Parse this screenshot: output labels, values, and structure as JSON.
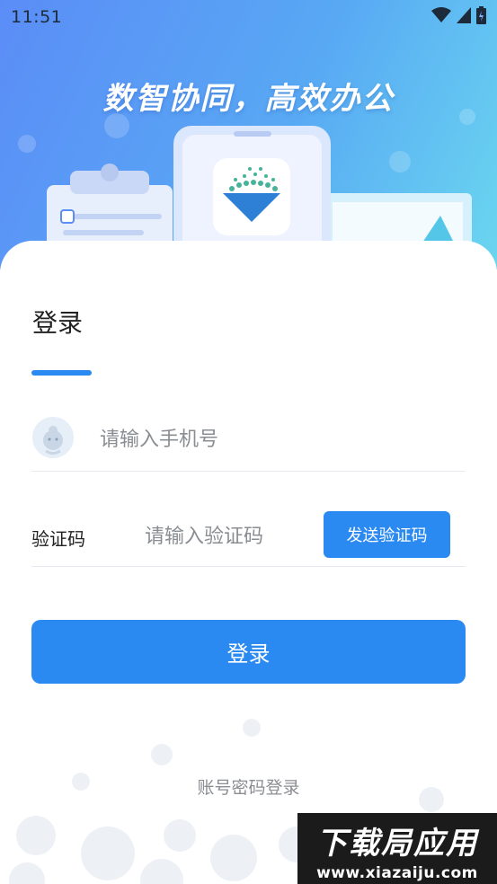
{
  "status_bar": {
    "time": "11:51"
  },
  "hero": {
    "slogan": "数智协同，高效办公",
    "app_icon": "app-logo-icon"
  },
  "login": {
    "title": "登录",
    "phone": {
      "placeholder": "请输入手机号",
      "value": ""
    },
    "code": {
      "label": "验证码",
      "placeholder": "请输入验证码",
      "value": ""
    },
    "send_code_label": "发送验证码",
    "submit_label": "登录",
    "password_login_link": "账号密码登录"
  },
  "watermark": {
    "main": "下载局应用",
    "sub": "www.xiazaiju.com"
  },
  "colors": {
    "accent": "#2b8af2",
    "hero_start": "#5b8df7",
    "hero_end": "#6ad6ef"
  }
}
